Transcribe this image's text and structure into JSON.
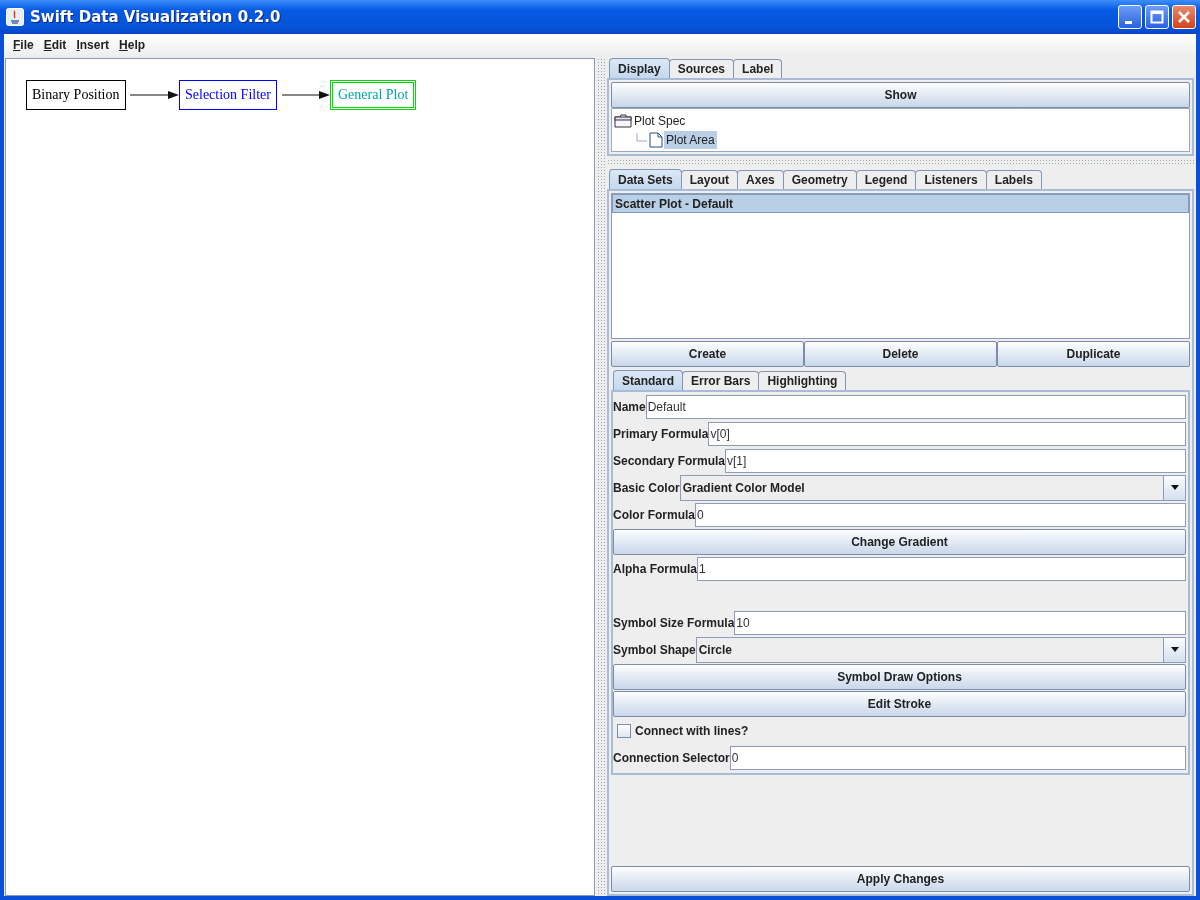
{
  "window": {
    "title": "Swift Data Visualization 0.2.0"
  },
  "menu": [
    "File",
    "Edit",
    "Insert",
    "Help"
  ],
  "diagram": {
    "nodes": [
      {
        "label": "Binary Position",
        "color": "#000000",
        "selected": false
      },
      {
        "label": "Selection Filter",
        "color": "#0000ff",
        "selected": false
      },
      {
        "label": "General Plot",
        "color": "#00a8a8",
        "selected": true
      }
    ]
  },
  "top_tabs": [
    {
      "label": "Display",
      "selected": true
    },
    {
      "label": "Sources",
      "selected": false
    },
    {
      "label": "Label",
      "selected": false
    }
  ],
  "show_button": "Show",
  "tree": [
    {
      "label": "Plot Spec",
      "selected": false,
      "children": [
        {
          "label": "Plot Area",
          "selected": true
        }
      ]
    }
  ],
  "inner_tabs": [
    {
      "label": "Data Sets",
      "selected": true
    },
    {
      "label": "Layout",
      "selected": false
    },
    {
      "label": "Axes",
      "selected": false
    },
    {
      "label": "Geometry",
      "selected": false
    },
    {
      "label": "Legend",
      "selected": false
    },
    {
      "label": "Listeners",
      "selected": false
    },
    {
      "label": "Labels",
      "selected": false
    }
  ],
  "data_sets": [
    {
      "label": "Scatter Plot - Default",
      "selected": true
    }
  ],
  "list_buttons": [
    "Create",
    "Delete",
    "Duplicate"
  ],
  "sub_tabs": [
    {
      "label": "Standard",
      "selected": true
    },
    {
      "label": "Error Bars",
      "selected": false
    },
    {
      "label": "Highlighting",
      "selected": false
    }
  ],
  "form": [
    {
      "kind": "field",
      "label": "Name",
      "value": "Default"
    },
    {
      "kind": "field",
      "label": "Primary Formula",
      "value": "v[0]"
    },
    {
      "kind": "field",
      "label": "Secondary Formula",
      "value": "v[1]"
    },
    {
      "kind": "combo",
      "label": "Basic Color",
      "value": "Gradient Color Model"
    },
    {
      "kind": "field",
      "label": "Color Formula",
      "value": "0"
    },
    {
      "kind": "button",
      "label": "Change Gradient"
    },
    {
      "kind": "field",
      "label": "Alpha Formula",
      "value": "1"
    },
    {
      "kind": "gap"
    },
    {
      "kind": "field",
      "label": "Symbol Size Formula",
      "value": "10"
    },
    {
      "kind": "combo",
      "label": "Symbol Shape",
      "value": "Circle"
    },
    {
      "kind": "button",
      "label": "Symbol Draw Options"
    },
    {
      "kind": "button",
      "label": "Edit Stroke"
    },
    {
      "kind": "checkbox",
      "label": "Connect with lines?",
      "checked": false
    },
    {
      "kind": "field",
      "label": "Connection Selector",
      "value": "0"
    }
  ],
  "apply_button": "Apply Changes"
}
